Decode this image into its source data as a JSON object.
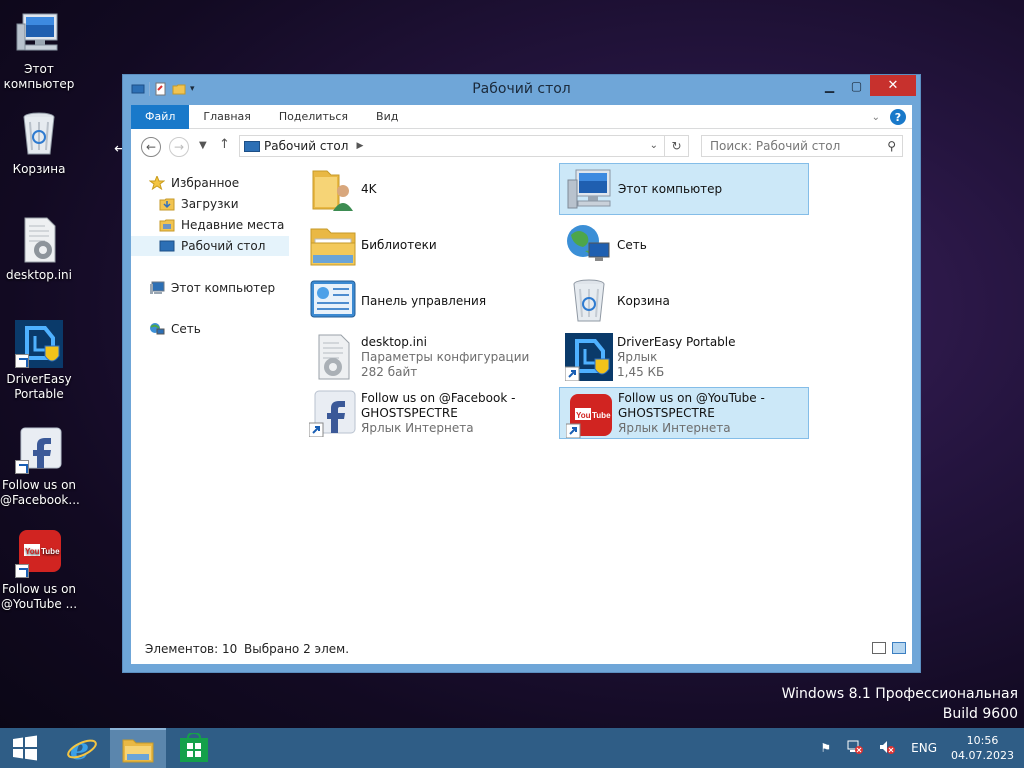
{
  "desktop": {
    "icons": [
      {
        "label": "Этот компьютер",
        "icon": "computer-icon"
      },
      {
        "label": "Корзина",
        "icon": "recycle-bin-icon"
      },
      {
        "label": "desktop.ini",
        "icon": "settings-file-icon"
      },
      {
        "label": "DriverEasy Portable",
        "icon": "drivereasy-icon"
      },
      {
        "label": "Follow us on @Facebook...",
        "icon": "facebook-icon"
      },
      {
        "label": "Follow us on @YouTube ...",
        "icon": "youtube-icon"
      }
    ],
    "watermark": {
      "line1": "Windows 8.1 Профессиональная",
      "line2": "Build 9600"
    }
  },
  "window": {
    "title": "Рабочий стол",
    "ribbon_tabs": [
      "Файл",
      "Главная",
      "Поделиться",
      "Вид"
    ],
    "address": {
      "crumb": "Рабочий стол"
    },
    "search": {
      "placeholder": "Поиск: Рабочий стол"
    },
    "nav": {
      "favorites": "Избранное",
      "downloads": "Загрузки",
      "recent": "Недавние места",
      "desktop": "Рабочий стол",
      "this_pc": "Этот компьютер",
      "network": "Сеть"
    },
    "items": [
      {
        "name": "4K",
        "sub1": "",
        "sub2": ""
      },
      {
        "name": "Этот компьютер",
        "sub1": "",
        "sub2": ""
      },
      {
        "name": "Библиотеки",
        "sub1": "",
        "sub2": ""
      },
      {
        "name": "Сеть",
        "sub1": "",
        "sub2": ""
      },
      {
        "name": "Панель управления",
        "sub1": "",
        "sub2": ""
      },
      {
        "name": "Корзина",
        "sub1": "",
        "sub2": ""
      },
      {
        "name": "desktop.ini",
        "sub1": "Параметры конфигурации",
        "sub2": "282 байт"
      },
      {
        "name": "DriverEasy Portable",
        "sub1": "Ярлык",
        "sub2": "1,45 КБ"
      },
      {
        "name": "Follow us on @Facebook -",
        "name2": "GHOSTSPECTRE",
        "sub1": "Ярлык Интернета"
      },
      {
        "name": "Follow us on @YouTube -",
        "name2": "GHOSTSPECTRE",
        "sub1": "Ярлык Интернета"
      }
    ],
    "status": {
      "count": "Элементов: 10",
      "selected": "Выбрано 2 элем."
    }
  },
  "taskbar": {
    "lang": "ENG",
    "time": "10:56",
    "date": "04.07.2023"
  },
  "colors": {
    "accent": "#1979ca",
    "taskbar": "#2f5d86",
    "close": "#c7312d",
    "selection": "#cce8f8"
  }
}
